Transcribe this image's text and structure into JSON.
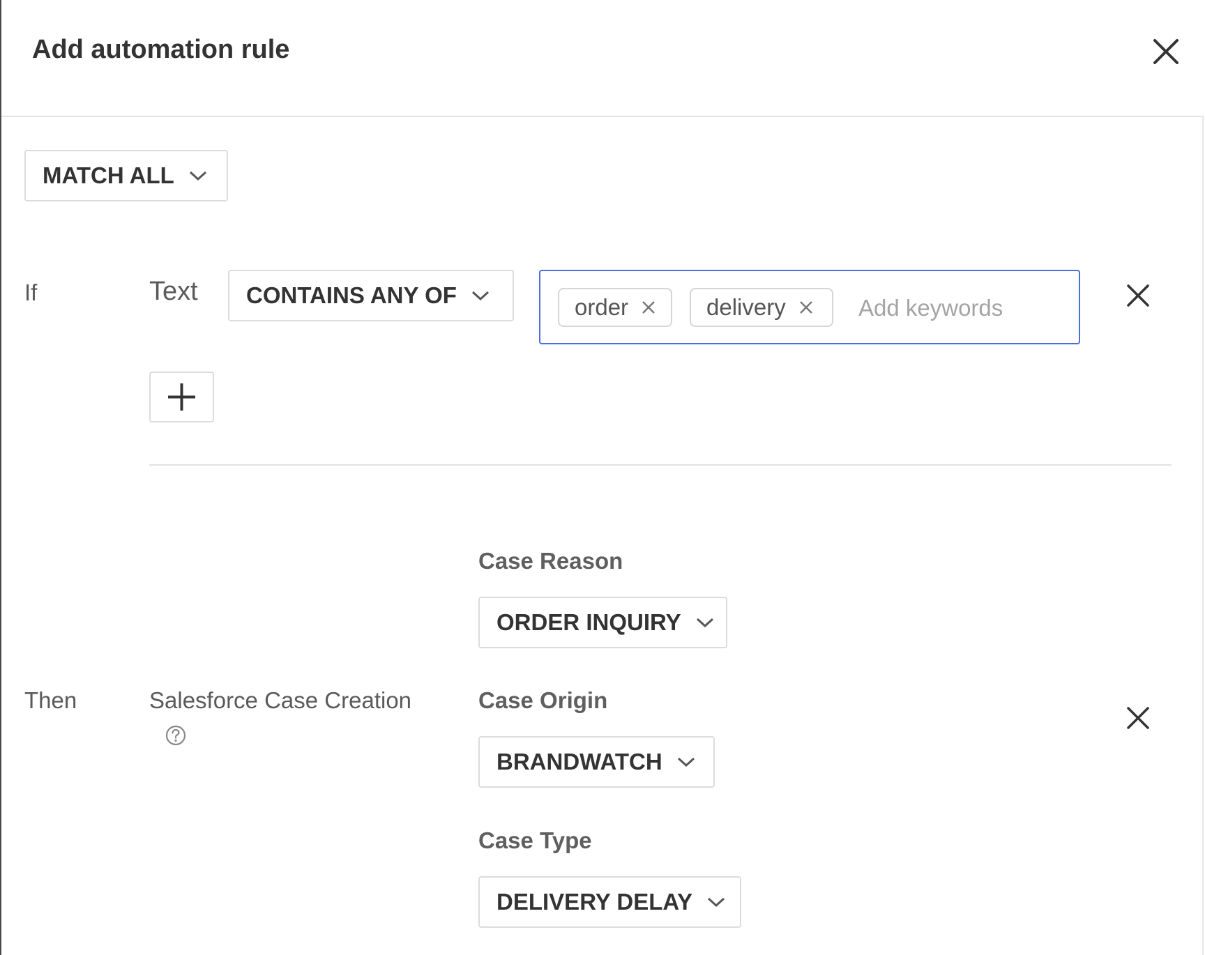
{
  "dialog": {
    "title": "Add automation rule"
  },
  "match_select": {
    "value": "MATCH ALL"
  },
  "condition": {
    "if_label": "If",
    "field_label": "Text",
    "operator_value": "CONTAINS ANY OF",
    "keywords": [
      "order",
      "delivery"
    ],
    "keyword_placeholder": "Add keywords"
  },
  "action": {
    "then_label": "Then",
    "action_name": "Salesforce Case Creation",
    "fields": [
      {
        "label": "Case Reason",
        "value": "ORDER INQUIRY"
      },
      {
        "label": "Case Origin",
        "value": "BRANDWATCH"
      },
      {
        "label": "Case Type",
        "value": "DELIVERY DELAY"
      }
    ]
  },
  "colors": {
    "focus_border": "#4a6fdc",
    "text_dark": "#333333",
    "border_light": "#dcdcdc"
  },
  "icons": [
    "close-icon",
    "chevron-down-icon",
    "plus-icon",
    "help-icon"
  ]
}
